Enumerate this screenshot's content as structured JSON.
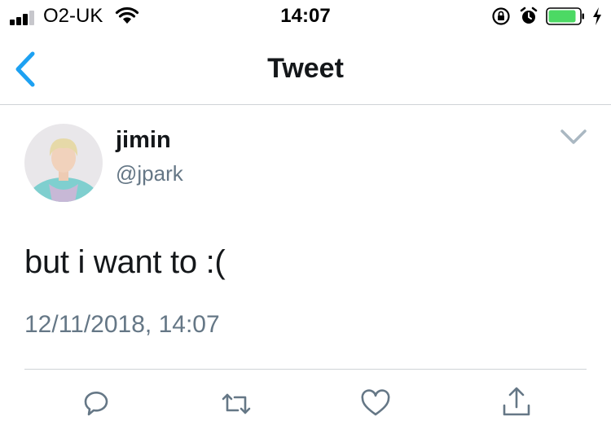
{
  "status_bar": {
    "carrier": "O2-UK",
    "time": "14:07",
    "battery_color": "#4cd964"
  },
  "nav": {
    "title": "Tweet"
  },
  "tweet": {
    "display_name": "jimin",
    "username": "@jpark",
    "text": "but i want to :(",
    "timestamp": "12/11/2018, 14:07"
  },
  "icons": {
    "back": "chevron-left-icon",
    "more": "chevron-down-icon",
    "reply": "reply-icon",
    "retweet": "retweet-icon",
    "like": "heart-icon",
    "share": "share-icon"
  },
  "colors": {
    "accent": "#1da1f2",
    "secondary_text": "#657786",
    "icon_gray": "#657786"
  }
}
